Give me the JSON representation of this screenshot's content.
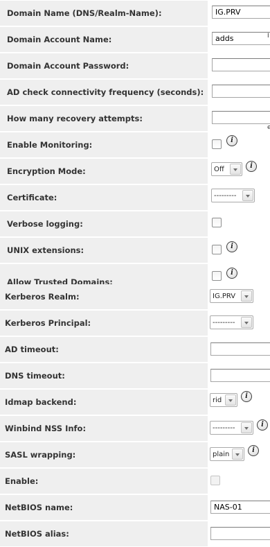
{
  "form": {
    "domain_name": {
      "label": "Domain Name (DNS/Realm-Name):",
      "value": "IG.PRV"
    },
    "domain_account_name": {
      "label": "Domain Account Name:",
      "value": "adds"
    },
    "domain_account_password": {
      "label": "Domain Account Password:",
      "value": ""
    },
    "ad_check_frequency": {
      "label": "AD check connectivity frequency (seconds):",
      "value": ""
    },
    "recovery_attempts": {
      "label": "How many recovery attempts:",
      "value": ""
    },
    "enable_monitoring": {
      "label": "Enable Monitoring:",
      "checked": false
    },
    "encryption_mode": {
      "label": "Encryption Mode:",
      "selected": "Off"
    },
    "certificate": {
      "label": "Certificate:",
      "selected": "---------"
    },
    "verbose_logging": {
      "label": "Verbose logging:",
      "checked": false
    },
    "unix_extensions": {
      "label": "UNIX extensions:",
      "checked": false
    },
    "allow_trusted_domains": {
      "label": "Allow Trusted Domains:",
      "checked": false
    },
    "kerberos_realm": {
      "label": "Kerberos Realm:",
      "selected": "IG.PRV"
    },
    "kerberos_principal": {
      "label": "Kerberos Principal:",
      "selected": "---------"
    },
    "ad_timeout": {
      "label": "AD timeout:",
      "value": ""
    },
    "dns_timeout": {
      "label": "DNS timeout:",
      "value": ""
    },
    "idmap_backend": {
      "label": "Idmap backend:",
      "selected": "rid"
    },
    "winbind_nss_info": {
      "label": "Winbind NSS Info:",
      "selected": "---------"
    },
    "sasl_wrapping": {
      "label": "SASL wrapping:",
      "selected": "plain"
    },
    "enable": {
      "label": "Enable:",
      "checked": false,
      "disabled": true
    },
    "netbios_name": {
      "label": "NetBIOS name:",
      "value": "NAS-01"
    },
    "netbios_alias": {
      "label": "NetBIOS alias:",
      "value": ""
    }
  },
  "edge_fragments": {
    "a": "I",
    "b": "e"
  },
  "icons": {
    "info": "info-icon",
    "dropdown": "chevron-down-icon"
  },
  "colors": {
    "label_bg": "#efefef",
    "label_text": "#333333",
    "input_border": "#a5a5a5"
  }
}
